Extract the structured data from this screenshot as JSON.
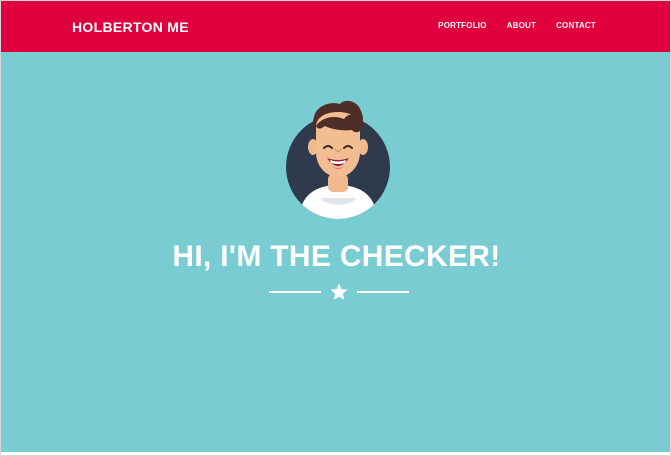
{
  "navbar": {
    "brand": "HOLBERTON ME",
    "links": [
      "PORTFOLIO",
      "ABOUT",
      "CONTACT"
    ]
  },
  "hero": {
    "headline": "HI, I'M THE CHECKER!",
    "avatar_icon": "smiling-avatar",
    "divider_icon": "star-icon"
  },
  "colors": {
    "navbar": "#e0003d",
    "hero": "#79ccd2",
    "text": "#ffffff"
  }
}
